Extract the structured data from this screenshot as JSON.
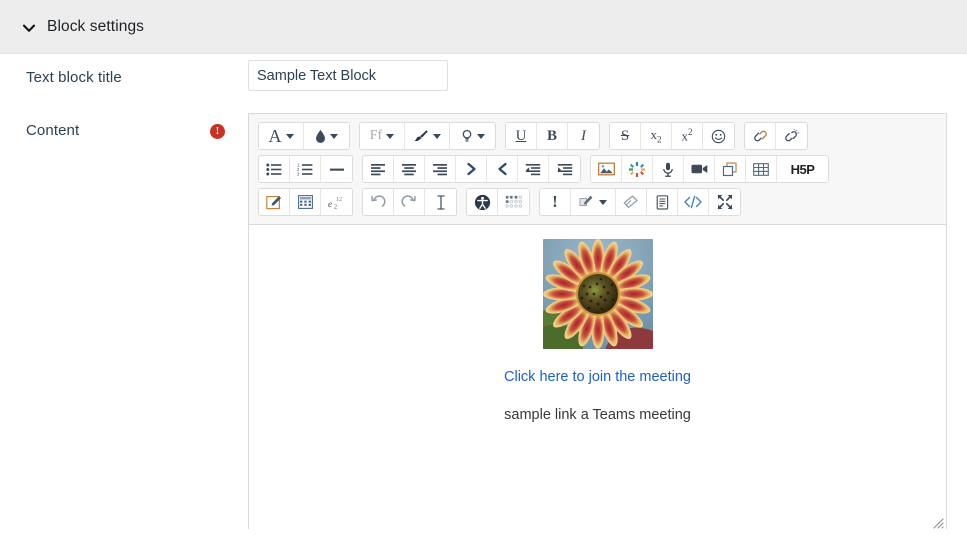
{
  "section": {
    "title": "Block settings",
    "chevron_icon": "chevron-down-icon",
    "expanded": true,
    "header_bg": "#ededed"
  },
  "form": {
    "title_field": {
      "label": "Text block title",
      "value": "Sample Text Block",
      "placeholder": ""
    },
    "content_field": {
      "label": "Content",
      "required_marker": "!",
      "required_color": "#ca3120"
    }
  },
  "editor": {
    "toolbar_rows": [
      {
        "groups": [
          {
            "buttons": [
              {
                "name": "style-paragraph-button",
                "icon": "letter-a-icon",
                "caret": true,
                "title": "Paragraph styles"
              },
              {
                "name": "background-color-button",
                "icon": "droplet-icon",
                "caret": true,
                "title": "Background colour"
              }
            ]
          },
          {
            "buttons": [
              {
                "name": "font-family-button",
                "icon": "font-family-icon",
                "label": "Ff",
                "caret": true,
                "title": "Font family"
              },
              {
                "name": "font-color-button",
                "icon": "paint-brush-icon",
                "caret": true,
                "title": "Font colour"
              },
              {
                "name": "highlight-button",
                "icon": "lightbulb-icon",
                "caret": true,
                "title": "Highlight"
              }
            ]
          },
          {
            "buttons": [
              {
                "name": "underline-button",
                "icon": "underline-icon",
                "label": "U",
                "title": "Underline"
              },
              {
                "name": "bold-button",
                "icon": "bold-icon",
                "label": "B",
                "title": "Bold"
              },
              {
                "name": "italic-button",
                "icon": "italic-icon",
                "label": "I",
                "title": "Italic"
              }
            ]
          },
          {
            "buttons": [
              {
                "name": "strikethrough-button",
                "icon": "strikethrough-icon",
                "label": "S",
                "title": "Strikethrough"
              },
              {
                "name": "subscript-button",
                "icon": "subscript-icon",
                "label": "x2",
                "title": "Subscript"
              },
              {
                "name": "superscript-button",
                "icon": "superscript-icon",
                "label": "x2",
                "title": "Superscript"
              },
              {
                "name": "emoticon-button",
                "icon": "smiley-icon",
                "title": "Emoticon"
              }
            ]
          },
          {
            "buttons": [
              {
                "name": "link-button",
                "icon": "link-icon",
                "title": "Link"
              },
              {
                "name": "unlink-button",
                "icon": "unlink-icon",
                "title": "Unlink"
              }
            ]
          }
        ]
      },
      {
        "groups": [
          {
            "buttons": [
              {
                "name": "bulleted-list-button",
                "icon": "bulleted-list-icon",
                "title": "Bulleted list"
              },
              {
                "name": "numbered-list-button",
                "icon": "numbered-list-icon",
                "title": "Numbered list"
              },
              {
                "name": "horizontal-rule-button",
                "icon": "horizontal-rule-icon",
                "title": "Horizontal rule"
              }
            ]
          },
          {
            "buttons": [
              {
                "name": "align-left-button",
                "icon": "align-left-icon",
                "title": "Align left"
              },
              {
                "name": "align-center-button",
                "icon": "align-center-icon",
                "title": "Align centre"
              },
              {
                "name": "align-right-button",
                "icon": "align-right-icon",
                "title": "Align right"
              },
              {
                "name": "ltr-button",
                "icon": "chevron-right-icon",
                "title": "Left to right"
              },
              {
                "name": "rtl-button",
                "icon": "chevron-left-icon",
                "title": "Right to left"
              },
              {
                "name": "outdent-button",
                "icon": "outdent-icon",
                "title": "Decrease indent"
              },
              {
                "name": "indent-button",
                "icon": "indent-icon",
                "title": "Increase indent"
              }
            ]
          },
          {
            "buttons": [
              {
                "name": "insert-image-button",
                "icon": "image-icon",
                "title": "Image"
              },
              {
                "name": "insert-media-button",
                "icon": "sparkle-icon",
                "title": "Insert media"
              },
              {
                "name": "record-audio-button",
                "icon": "microphone-icon",
                "title": "Record audio"
              },
              {
                "name": "record-video-button",
                "icon": "video-camera-icon",
                "title": "Record video"
              },
              {
                "name": "manage-files-button",
                "icon": "copy-files-icon",
                "title": "Manage files"
              },
              {
                "name": "insert-table-button",
                "icon": "table-icon",
                "title": "Table"
              },
              {
                "name": "h5p-button",
                "icon": "h5p-icon",
                "label": "H5P",
                "title": "Insert H5P"
              }
            ]
          }
        ]
      },
      {
        "groups": [
          {
            "buttons": [
              {
                "name": "equation-editor-button",
                "icon": "pencil-square-icon",
                "title": "Equation editor"
              },
              {
                "name": "calculator-button",
                "icon": "calculator-icon",
                "title": "Calculator"
              },
              {
                "name": "chemistry-editor-button",
                "icon": "chemistry-icon",
                "title": "Chemistry editor"
              }
            ]
          },
          {
            "buttons": [
              {
                "name": "undo-button",
                "icon": "undo-icon",
                "title": "Undo"
              },
              {
                "name": "redo-button",
                "icon": "redo-icon",
                "title": "Redo"
              },
              {
                "name": "clear-formatting-button",
                "icon": "text-cursor-icon",
                "title": "Clear formatting"
              }
            ]
          },
          {
            "buttons": [
              {
                "name": "accessibility-checker-button",
                "icon": "accessibility-icon",
                "title": "Accessibility checker"
              },
              {
                "name": "screenreader-helper-button",
                "icon": "braille-icon",
                "title": "Screenreader helper"
              }
            ]
          },
          {
            "buttons": [
              {
                "name": "insert-character-button",
                "icon": "exclamation-icon",
                "title": "Insert character"
              },
              {
                "name": "draw-button",
                "icon": "pen-paper-icon",
                "caret": true,
                "title": "Draw"
              },
              {
                "name": "eraser-button",
                "icon": "eraser-icon",
                "title": "Erase"
              },
              {
                "name": "paste-document-button",
                "icon": "document-icon",
                "title": "Paste from document"
              },
              {
                "name": "html-source-button",
                "icon": "code-icon",
                "label": "</>",
                "title": "HTML source"
              },
              {
                "name": "fullscreen-button",
                "icon": "expand-arrows-icon",
                "title": "Fullscreen"
              }
            ]
          }
        ]
      }
    ],
    "content": {
      "image_alt": "sunflower-image",
      "link_text": "Click here to join the meeting",
      "link_color": "#1b5fd4",
      "paragraph_text": "sample link a Teams meeting"
    },
    "resize_handle_icon": "resize-grip-icon"
  }
}
